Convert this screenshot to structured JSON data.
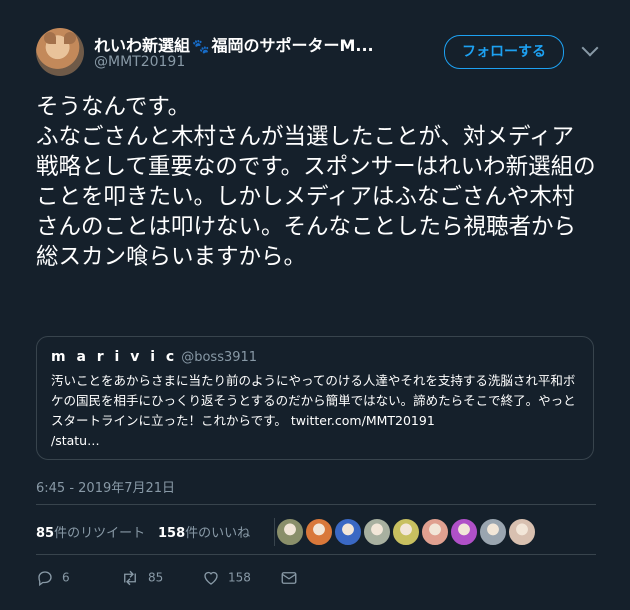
{
  "author": {
    "name_part1": "れいわ新選組",
    "paw_icon": "🐾",
    "name_part2": "福岡のサポーターM...",
    "handle": "@MMT20191"
  },
  "follow_button": "フォローする",
  "tweet_text": "そうなんです。\nふなごさんと木村さんが当選したことが、対メディア戦略として重要なのです。スポンサーはれいわ新選組のことを叩きたい。しかしメディアはふなごさんや木村さんのことは叩けない。そんなことしたら視聴者から総スカン喰らいますから。",
  "quote": {
    "name": "m a r i v i c",
    "handle": "@boss3911",
    "text": "汚いことをあからさまに当たり前のようにやってのける人達やそれを支持する洗脳され平和ボケの国民を相手にひっくり返そうとするのだから簡単ではない。諦めたらそこで終了。やっとスタートラインに立った！これからです。 twitter.com/MMT20191\n/statu…"
  },
  "timestamp": "6:45 - 2019年7月21日",
  "stats": {
    "retweets_count": "85",
    "retweets_label": "件のリツイート",
    "likes_count": "158",
    "likes_label": "件のいいね"
  },
  "likers": [
    {
      "name": "liker-avatar-1",
      "color": "#8a8f6a"
    },
    {
      "name": "liker-avatar-2",
      "color": "#d9783a"
    },
    {
      "name": "liker-avatar-3",
      "color": "#3a68c4"
    },
    {
      "name": "liker-avatar-4",
      "color": "#a8b0a0"
    },
    {
      "name": "liker-avatar-5",
      "color": "#c8c060"
    },
    {
      "name": "liker-avatar-6",
      "color": "#e0a090"
    },
    {
      "name": "liker-avatar-7",
      "color": "#b050c8"
    },
    {
      "name": "liker-avatar-8",
      "color": "#9aa5b0"
    },
    {
      "name": "liker-avatar-9",
      "color": "#d8c0b0"
    }
  ],
  "actions": {
    "reply_count": "6",
    "retweet_count": "85",
    "like_count": "158"
  }
}
